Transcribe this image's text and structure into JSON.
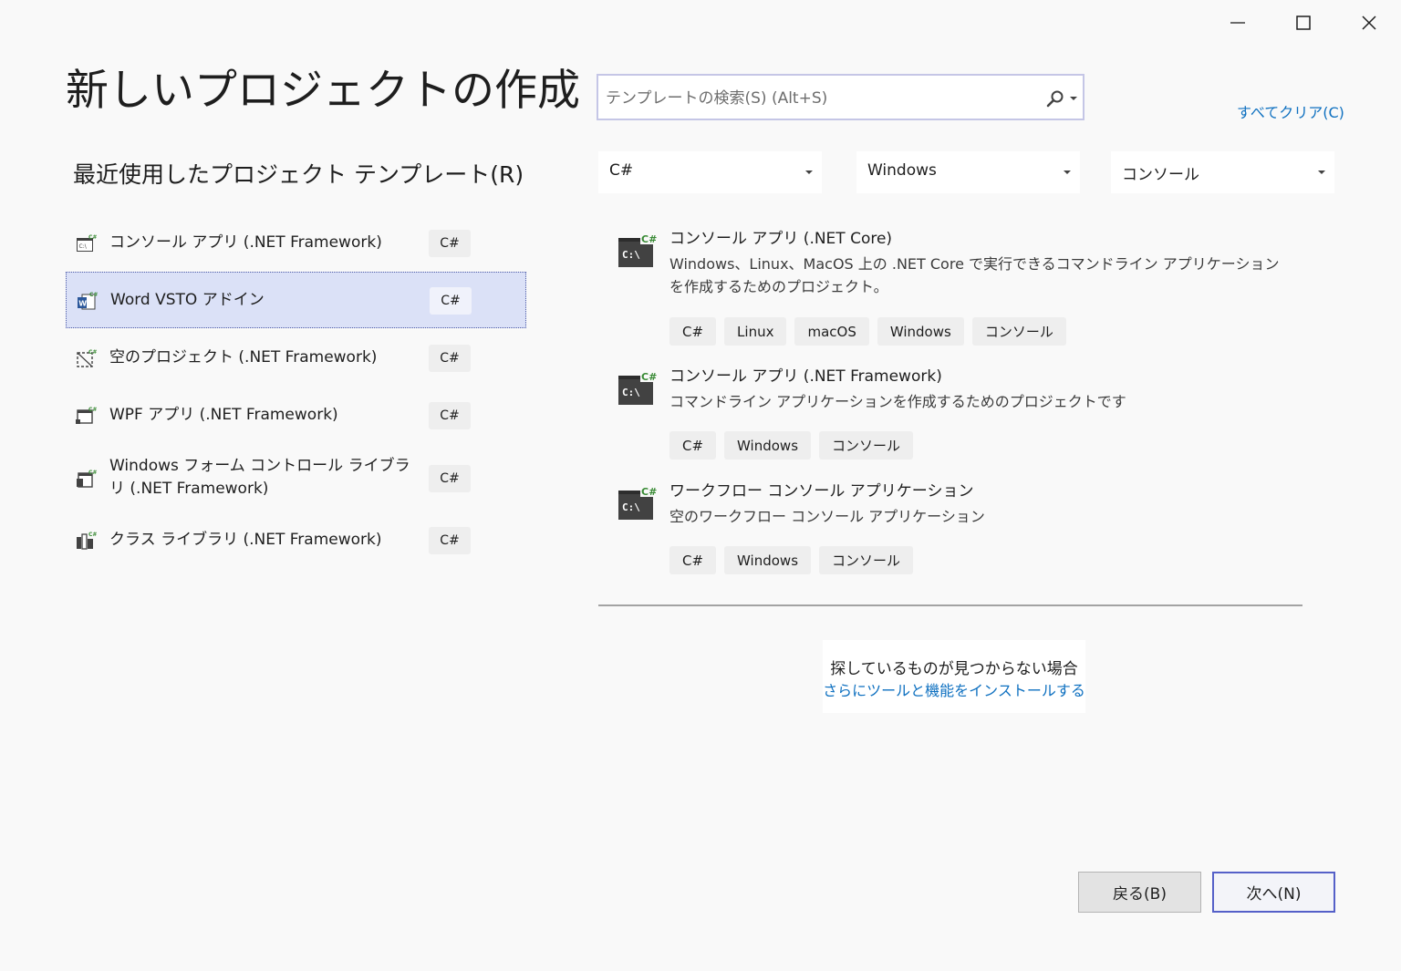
{
  "window": {
    "minimize_icon": "minimize-icon",
    "maximize_icon": "maximize-icon",
    "close_icon": "close-icon"
  },
  "title": "新しいプロジェクトの作成",
  "recent": {
    "header": "最近使用したプロジェクト テンプレート(R)",
    "items": [
      {
        "label": "コンソール アプリ (.NET Framework)",
        "badge": "C#",
        "icon": "console-app-icon"
      },
      {
        "label": "Word VSTO アドイン",
        "badge": "C#",
        "icon": "word-addin-icon",
        "selected": true
      },
      {
        "label": "空のプロジェクト (.NET Framework)",
        "badge": "C#",
        "icon": "empty-project-icon"
      },
      {
        "label": "WPF アプリ (.NET Framework)",
        "badge": "C#",
        "icon": "wpf-app-icon"
      },
      {
        "label": "Windows フォーム コントロール ライブラリ (.NET Framework)",
        "badge": "C#",
        "icon": "winforms-control-library-icon"
      },
      {
        "label": "クラス ライブラリ (.NET Framework)",
        "badge": "C#",
        "icon": "class-library-icon"
      }
    ]
  },
  "search": {
    "placeholder": "テンプレートの検索(S) (Alt+S)",
    "value": ""
  },
  "clear_all": "すべてクリア(C)",
  "filters": {
    "language": "C#",
    "platform": "Windows",
    "project_type": "コンソール"
  },
  "templates": [
    {
      "name": "コンソール アプリ (.NET Core)",
      "description": "Windows、Linux、MacOS 上の .NET Core で実行できるコマンドライン アプリケーションを作成するためのプロジェクト。",
      "tags": [
        "C#",
        "Linux",
        "macOS",
        "Windows",
        "コンソール"
      ],
      "icon": "csharp-console-icon"
    },
    {
      "name": "コンソール アプリ (.NET Framework)",
      "description": "コマンドライン アプリケーションを作成するためのプロジェクトです",
      "tags": [
        "C#",
        "Windows",
        "コンソール"
      ],
      "icon": "csharp-console-icon"
    },
    {
      "name": "ワークフロー コンソール アプリケーション",
      "description": "空のワークフロー コンソール アプリケーション",
      "tags": [
        "C#",
        "Windows",
        "コンソール"
      ],
      "icon": "csharp-console-icon"
    }
  ],
  "not_found": {
    "text": "探しているものが見つからない場合",
    "link": "さらにツールと機能をインストールする"
  },
  "buttons": {
    "back": "戻る(B)",
    "next": "次へ(N)"
  },
  "colors": {
    "background": "#f9f9f9",
    "selected_item": "#dbe1f7",
    "link": "#0e70c0",
    "primary_border": "#5560c8",
    "csharp_green": "#388a34"
  }
}
